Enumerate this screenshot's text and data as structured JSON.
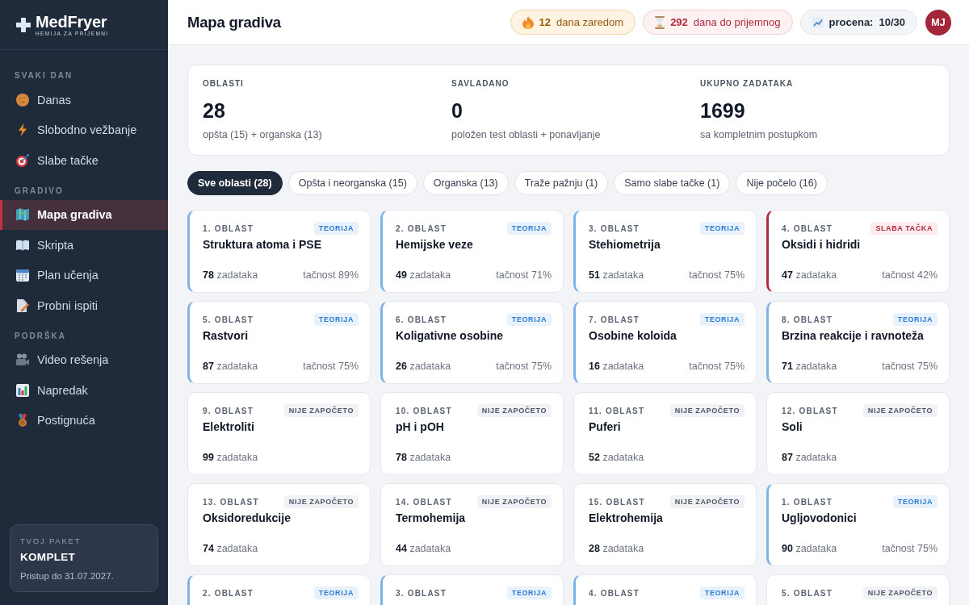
{
  "sidebar": {
    "logo": {
      "name": "MedFryer",
      "tagline": "HEMIJA ZA PRIJEMNI"
    },
    "sections": [
      {
        "title": "SVAKI DAN",
        "items": [
          {
            "label": "Danas",
            "selected": false
          },
          {
            "label": "Slobodno vežbanje",
            "selected": false
          },
          {
            "label": "Slabe tačke",
            "selected": false
          }
        ]
      },
      {
        "title": "GRADIVO",
        "items": [
          {
            "label": "Mapa gradiva",
            "selected": true
          },
          {
            "label": "Skripta",
            "selected": false
          },
          {
            "label": "Plan učenja",
            "selected": false
          },
          {
            "label": "Probni ispiti",
            "selected": false
          }
        ]
      },
      {
        "title": "PODRŠKA",
        "items": [
          {
            "label": "Video rešenja",
            "selected": false
          },
          {
            "label": "Napredak",
            "selected": false
          },
          {
            "label": "Postignuća",
            "selected": false
          }
        ]
      }
    ],
    "package": {
      "label": "TVOJ PAKET",
      "name": "KOMPLET",
      "note": "Pristup do 31.07.2027."
    }
  },
  "header": {
    "title": "Mapa gradiva",
    "pills": [
      {
        "kind": "streak",
        "value": "12",
        "label": "dana zaredom"
      },
      {
        "kind": "countdown",
        "value": "292",
        "label": "dana do prijemnog"
      },
      {
        "kind": "score",
        "label": "procena:",
        "value": "10/30"
      }
    ],
    "avatar": "MJ"
  },
  "stats": [
    {
      "label": "OBLASTI",
      "value": "28",
      "note": "opšta (15) + organska (13)"
    },
    {
      "label": "SAVLADANO",
      "value": "0",
      "note": "položen test oblasti + ponavljanje"
    },
    {
      "label": "UKUPNO ZADATAKA",
      "value": "1699",
      "note": "sa kompletnim postupkom"
    }
  ],
  "filters": [
    {
      "label": "Sve oblasti (28)",
      "selected": true
    },
    {
      "label": "Opšta i neorganska (15)",
      "selected": false
    },
    {
      "label": "Organska (13)",
      "selected": false
    },
    {
      "label": "Traže pažnju (1)",
      "selected": false
    },
    {
      "label": "Samo slabe tačke (1)",
      "selected": false
    },
    {
      "label": "Nije počelo (16)",
      "selected": false
    }
  ],
  "areas": [
    {
      "number": "1. OBLAST",
      "kind": "theory",
      "badge": "TEORIJA",
      "title": "Struktura atoma i PSE",
      "tasks": "**78** zadataka",
      "accuracy": "tačnost 89%"
    },
    {
      "number": "2. OBLAST",
      "kind": "theory",
      "badge": "TEORIJA",
      "title": "Hemijske veze",
      "tasks": "**49** zadataka",
      "accuracy": "tačnost 71%"
    },
    {
      "number": "3. OBLAST",
      "kind": "theory",
      "badge": "TEORIJA",
      "title": "Stehiometrija",
      "tasks": "**51** zadataka",
      "accuracy": "tačnost 75%"
    },
    {
      "number": "4. OBLAST",
      "kind": "weak",
      "badge": "SLABA TAČKA",
      "title": "Oksidi i hidridi",
      "tasks": "**47** zadataka",
      "accuracy": "tačnost 42%"
    },
    {
      "number": "5. OBLAST",
      "kind": "theory",
      "badge": "TEORIJA",
      "title": "Rastvori",
      "tasks": "**87** zadataka",
      "accuracy": "tačnost 75%"
    },
    {
      "number": "6. OBLAST",
      "kind": "theory",
      "badge": "TEORIJA",
      "title": "Koligativne osobine",
      "tasks": "**26** zadataka",
      "accuracy": "tačnost 75%"
    },
    {
      "number": "7. OBLAST",
      "kind": "theory",
      "badge": "TEORIJA",
      "title": "Osobine koloida",
      "tasks": "**16** zadataka",
      "accuracy": "tačnost 75%"
    },
    {
      "number": "8. OBLAST",
      "kind": "theory",
      "badge": "TEORIJA",
      "title": "Brzina reakcije i ravnoteža",
      "tasks": "**71** zadataka",
      "accuracy": "tačnost 75%"
    },
    {
      "number": "9. OBLAST",
      "kind": "not_started",
      "badge": "NIJE ZAPOČETO",
      "title": "Elektroliti",
      "tasks": "**99** zadataka"
    },
    {
      "number": "10. OBLAST",
      "kind": "not_started",
      "badge": "NIJE ZAPOČETO",
      "title": "pH i pOH",
      "tasks": "**78** zadataka"
    },
    {
      "number": "11. OBLAST",
      "kind": "not_started",
      "badge": "NIJE ZAPOČETO",
      "title": "Puferi",
      "tasks": "**52** zadataka"
    },
    {
      "number": "12. OBLAST",
      "kind": "not_started",
      "badge": "NIJE ZAPOČETO",
      "title": "Soli",
      "tasks": "**87** zadataka"
    },
    {
      "number": "13. OBLAST",
      "kind": "not_started",
      "badge": "NIJE ZAPOČETO",
      "title": "Oksidoredukcije",
      "tasks": "**74** zadataka"
    },
    {
      "number": "14. OBLAST",
      "kind": "not_started",
      "badge": "NIJE ZAPOČETO",
      "title": "Termohemija",
      "tasks": "**44** zadataka"
    },
    {
      "number": "15. OBLAST",
      "kind": "not_started",
      "badge": "NIJE ZAPOČETO",
      "title": "Elektrohemija",
      "tasks": "**28** zadataka"
    },
    {
      "number": "1. OBLAST",
      "kind": "theory",
      "badge": "TEORIJA",
      "title": "Ugljovodonici",
      "tasks": "**90** zadataka",
      "accuracy": "tačnost 75%"
    },
    {
      "number": "2. OBLAST",
      "kind": "theory",
      "badge": "TEORIJA"
    },
    {
      "number": "3. OBLAST",
      "kind": "theory",
      "badge": "TEORIJA"
    },
    {
      "number": "4. OBLAST",
      "kind": "theory",
      "badge": "TEORIJA"
    },
    {
      "number": "5. OBLAST",
      "kind": "not_started",
      "badge": "NIJE ZAPOČETO"
    }
  ]
}
